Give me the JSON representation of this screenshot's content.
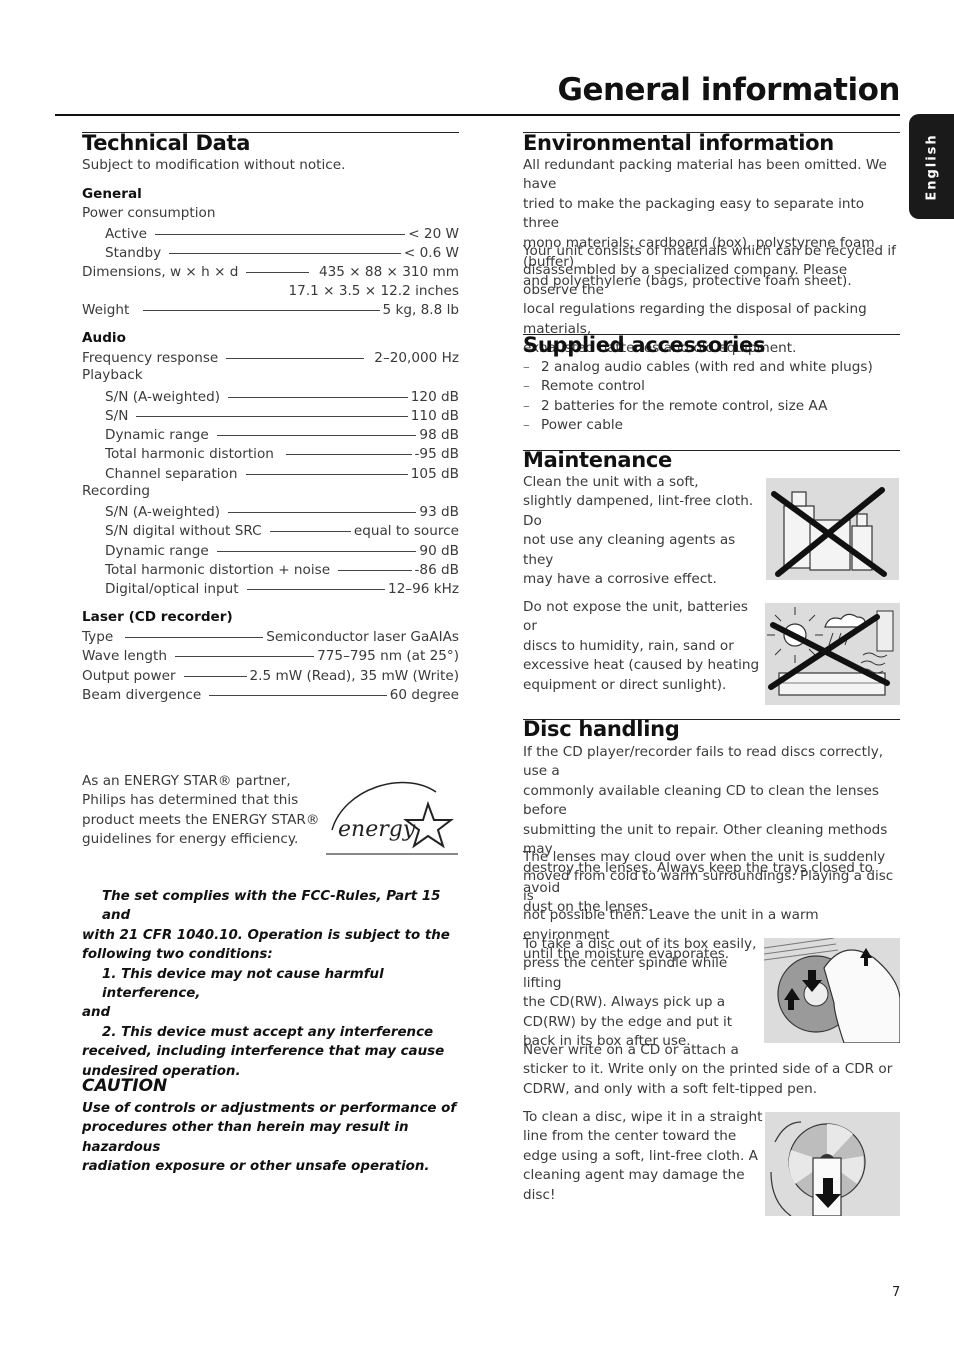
{
  "page": {
    "title": "General information",
    "language_tab": "English",
    "page_number": "7"
  },
  "technical_data": {
    "heading": "Technical Data",
    "subtitle": "Subject to modification without notice.",
    "general": {
      "heading": "General",
      "power_label": "Power consumption",
      "rows": [
        {
          "label": "Active",
          "value": "< 20 W"
        },
        {
          "label": "Standby",
          "value": "< 0.6 W"
        },
        {
          "label": "Dimensions, w × h × d",
          "value": "435 × 88 × 310 mm"
        },
        {
          "label": "",
          "value": "17.1 × 3.5 × 12.2 inches"
        },
        {
          "label": "Weight",
          "value": "5 kg, 8.8 lb"
        }
      ]
    },
    "audio": {
      "heading": "Audio",
      "frequency": {
        "label": "Frequency response",
        "value": "2–20,000 Hz"
      },
      "playback_label": "Playback",
      "playback": [
        {
          "label": "S/N (A-weighted)",
          "value": "120 dB"
        },
        {
          "label": "S/N",
          "value": "110 dB"
        },
        {
          "label": "Dynamic range",
          "value": "98 dB"
        },
        {
          "label": "Total harmonic distortion",
          "value": "-95 dB"
        },
        {
          "label": "Channel separation",
          "value": "105 dB"
        }
      ],
      "recording_label": "Recording",
      "recording": [
        {
          "label": "S/N (A-weighted)",
          "value": "93 dB"
        },
        {
          "label": "S/N digital without SRC",
          "value": "equal to source"
        },
        {
          "label": "Dynamic range",
          "value": "90 dB"
        },
        {
          "label": "Total harmonic distortion + noise",
          "value": "-86 dB"
        },
        {
          "label": "Digital/optical input",
          "value": "12–96 kHz"
        }
      ]
    },
    "laser": {
      "heading": "Laser (CD recorder)",
      "rows": [
        {
          "label": "Type",
          "value": "Semiconductor laser GaAIAs"
        },
        {
          "label": "Wave length",
          "value": "775–795 nm (at 25°)"
        },
        {
          "label": "Output power",
          "value": "2.5 mW (Read), 35 mW (Write)"
        },
        {
          "label": "Beam divergence",
          "value": "60 degree"
        }
      ]
    }
  },
  "energy_star": {
    "lines": [
      "As an ENERGY STAR® partner,",
      "Philips has determined that this",
      "product meets the ENERGY STAR®",
      "guidelines for energy efficiency."
    ],
    "logo_text": "energy"
  },
  "fcc": {
    "lines": [
      "The set complies with the FCC-Rules, Part 15 and",
      "with 21 CFR 1040.10. Operation is subject to the",
      "following two conditions:",
      "1. This device may not cause harmful interference,",
      "and",
      "2. This device must accept any interference",
      "received, including interference that may cause",
      "undesired operation."
    ]
  },
  "caution": {
    "heading": "CAUTION",
    "lines": [
      "Use of controls or adjustments or performance of",
      "procedures other than herein may result in hazardous",
      "radiation exposure or other unsafe operation."
    ]
  },
  "environmental": {
    "heading": "Environmental information",
    "para1": [
      "All redundant packing material has been omitted. We have",
      "tried to make the packaging easy to separate into three",
      "mono materials: cardboard (box), polystyrene foam (buffer)",
      "and polyethylene (bags, protective foam sheet)."
    ],
    "para2": [
      "Your unit consists of materials which can be recycled if",
      "disassembled by a specialized company. Please observe the",
      "local regulations regarding the disposal of packing materials,",
      "exhausted batteries and old equipment."
    ]
  },
  "accessories": {
    "heading": "Supplied accessories",
    "bullet": "–",
    "items": [
      "2 analog audio cables (with red and white plugs)",
      "Remote control",
      "2 batteries for the remote control, size AA",
      "Power cable"
    ]
  },
  "maintenance": {
    "heading": "Maintenance",
    "para1": [
      "Clean the unit with a soft,",
      "slightly dampened, lint-free cloth. Do",
      "not use any cleaning agents as they",
      "may have a corrosive effect."
    ],
    "para2": [
      "Do not expose the unit, batteries or",
      "discs to humidity, rain, sand or",
      "excessive heat (caused by heating",
      "equipment or direct sunlight)."
    ]
  },
  "disc_handling": {
    "heading": "Disc handling",
    "para1": [
      "If the CD player/recorder fails to read discs correctly, use a",
      "commonly available cleaning CD to clean the lenses before",
      "submitting the unit to repair. Other cleaning methods may",
      "destroy the lenses. Always keep the trays closed to avoid",
      "dust on the lenses."
    ],
    "para2": [
      "The lenses may cloud over when the unit is suddenly",
      "moved from cold to warm surroundings. Playing a disc is",
      "not possible then. Leave the unit in a warm environment",
      "until the moisture evaporates."
    ],
    "para3": [
      "To take a disc out of its box easily,",
      "press the center spindle while lifting",
      "the CD(RW). Always pick up a",
      "CD(RW) by the edge and put it",
      "back in its box after use."
    ],
    "para4": [
      "Never write on a CD or attach a",
      "sticker to it. Write only on the printed side of a CDR or",
      "CDRW, and only with a soft felt-tipped pen."
    ],
    "para5": [
      "To clean a disc, wipe it in a straight",
      "line from the center toward the",
      "edge using a soft, lint-free cloth. A",
      "cleaning agent may damage the disc!"
    ]
  }
}
